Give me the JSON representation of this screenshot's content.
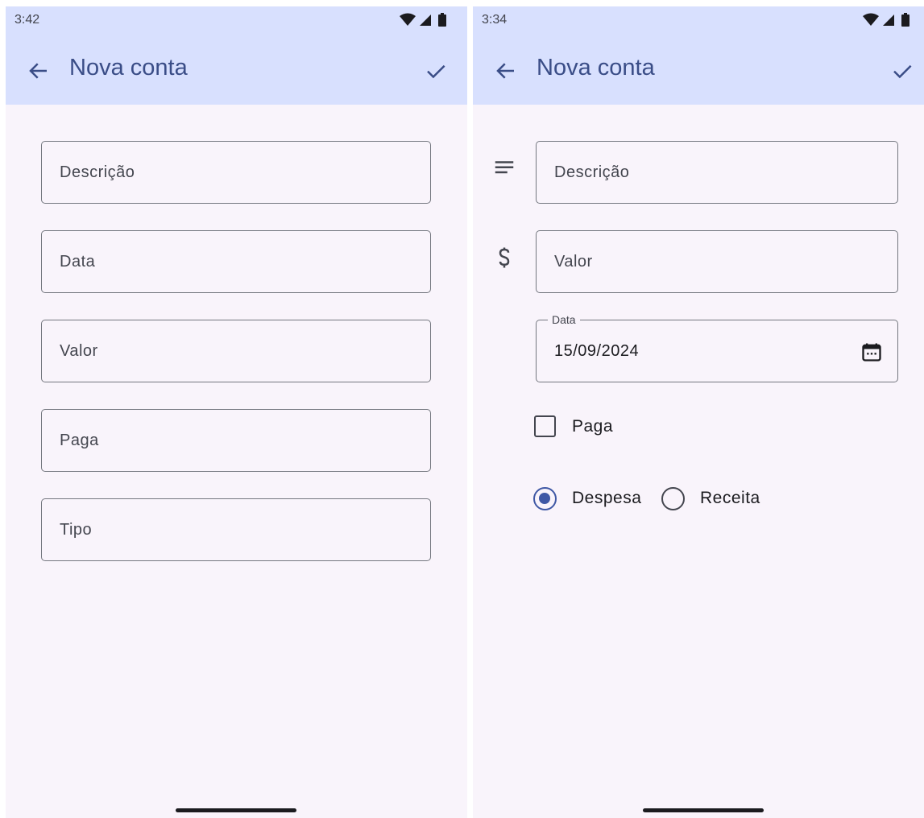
{
  "app_title": "Nova conta",
  "left_screen": {
    "status_time": "3:42",
    "fields": [
      {
        "label": "Descrição"
      },
      {
        "label": "Data"
      },
      {
        "label": "Valor"
      },
      {
        "label": "Paga"
      },
      {
        "label": "Tipo"
      }
    ]
  },
  "right_screen": {
    "status_time": "3:34",
    "descricao_label": "Descrição",
    "valor_label": "Valor",
    "data_label": "Data",
    "data_value": "15/09/2024",
    "paga_label": "Paga",
    "paga_checked": false,
    "type_options": [
      {
        "label": "Despesa",
        "selected": true
      },
      {
        "label": "Receita",
        "selected": false
      }
    ]
  },
  "colors": {
    "app_bar_background": "#d8e0fe",
    "page_background": "#f9f4fb",
    "primary": "#3f58a5",
    "outline": "#74777f"
  },
  "icons": [
    "back-arrow-icon",
    "check-icon",
    "wifi-icon",
    "signal-icon",
    "battery-icon",
    "notes-icon",
    "dollar-icon",
    "calendar-icon"
  ]
}
